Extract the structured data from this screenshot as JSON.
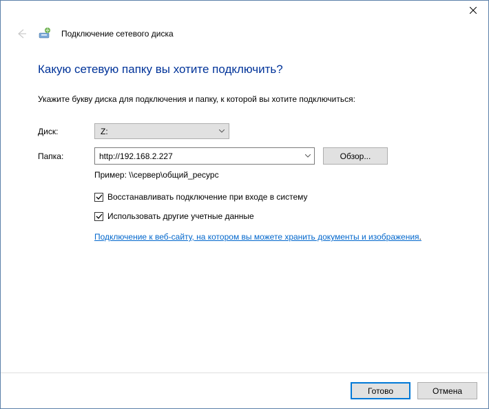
{
  "titlebar": {
    "close": "×"
  },
  "header": {
    "title": "Подключение сетевого диска"
  },
  "heading": "Какую сетевую папку вы хотите подключить?",
  "instruction": "Укажите букву диска для подключения и папку, к которой вы хотите подключиться:",
  "form": {
    "drive_label": "Диск:",
    "drive_value": "Z:",
    "folder_label": "Папка:",
    "folder_value": "http://192.168.2.227",
    "browse_label": "Обзор...",
    "example": "Пример: \\\\сервер\\общий_ресурс",
    "reconnect_label": "Восстанавливать подключение при входе в систему",
    "other_creds_label": "Использовать другие учетные данные",
    "link_text": "Подключение к веб-сайту, на котором вы можете хранить документы и изображения"
  },
  "footer": {
    "finish": "Готово",
    "cancel": "Отмена"
  }
}
